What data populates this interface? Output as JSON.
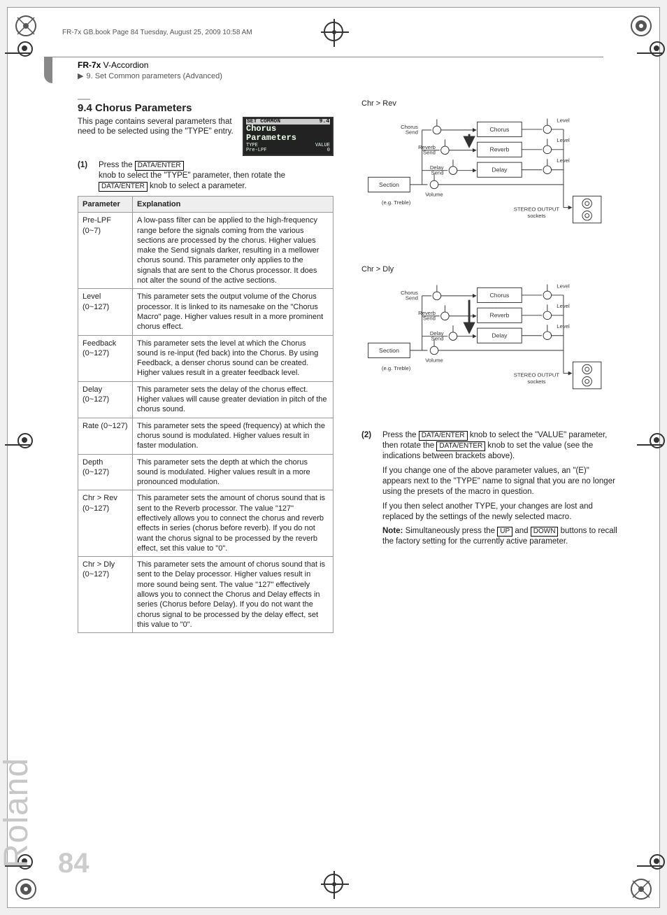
{
  "running_head": "FR-7x GB.book  Page 84  Tuesday, August 25, 2009  10:58 AM",
  "header": {
    "product_bold": "FR-7x",
    "product_rest": " V-Accordion",
    "section_nav": "9. Set Common parameters (Advanced)"
  },
  "section": {
    "title": "9.4 Chorus Parameters",
    "intro": "This page contains several parameters that need to be selected using the \"TYPE\" entry.",
    "lcd": {
      "bar_left": "SET COMMON",
      "bar_right": "9.4",
      "l2": "Chorus",
      "l3": "Parameters",
      "l4a": "TYPE",
      "l4b": "VALUE",
      "l5a": "Pre-LPF",
      "l5b": "0"
    }
  },
  "step1": {
    "num": "(1)",
    "line1_before": "Press the ",
    "btn": "DATA/ENTER",
    "line2": "knob to select the \"TYPE\" parameter, then rotate the ",
    "line3": " knob to select a parameter."
  },
  "table_head": {
    "c1": "Parameter",
    "c2": "Explanation"
  },
  "rows": [
    {
      "p": "Pre-LPF (0~7)",
      "e": "A low-pass filter can be applied to the high-frequency range before the signals coming from the various sections are processed by the chorus. Higher values make the Send signals darker, resulting in a mellower chorus sound. This parameter only applies to the signals that are sent to the Chorus processor. It does not alter the sound of the active sections."
    },
    {
      "p": "Level (0~127)",
      "e": "This parameter sets the output volume of the Chorus processor. It is linked to its namesake on the \"Chorus Macro\" page. Higher values result in a more prominent chorus effect."
    },
    {
      "p": "Feedback (0~127)",
      "e": "This parameter sets the level at which the Chorus sound is re-input (fed back) into the Chorus. By using Feedback, a denser chorus sound can be created. Higher values result in a greater feedback level."
    },
    {
      "p": "Delay (0~127)",
      "e": "This parameter sets the delay of the chorus effect. Higher values will cause greater deviation in pitch of the chorus sound."
    },
    {
      "p": "Rate (0~127)",
      "e": "This parameter sets the speed (frequency) at which the chorus sound is modulated. Higher values result in faster modulation."
    },
    {
      "p": "Depth (0~127)",
      "e": "This parameter sets the depth at which the chorus sound is modulated. Higher values result in a more pronounced modulation."
    },
    {
      "p": "Chr > Rev (0~127)",
      "e": "This parameter sets the amount of chorus sound that is sent to the Reverb processor. The value \"127\" effectively allows you to connect the chorus and reverb effects in series (chorus before reverb). If you do not want the chorus signal to be processed by the reverb effect, set this value to \"0\"."
    },
    {
      "p": "Chr > Dly (0~127)",
      "e": "This parameter sets the amount of chorus sound that is sent to the Delay processor. Higher values result in more sound being sent. The value \"127\" effectively allows you to connect the Chorus and Delay effects in series (Chorus before Delay). If you do not want the chorus signal to be processed by the delay effect, set this value to \"0\"."
    }
  ],
  "diagrams": {
    "d1": {
      "title": "Chr > Rev",
      "section": "Section",
      "section_eg": "(e.g. Treble)",
      "volume": "Volume",
      "chorus_send": "Chorus\nSend",
      "reverb_send": "Reverb\nSend",
      "delay_send": "Delay\nSend",
      "chorus": "Chorus",
      "reverb": "Reverb",
      "delay": "Delay",
      "level": "Level",
      "out": "STEREO OUTPUT\nsockets"
    },
    "d2": {
      "title": "Chr > Dly"
    }
  },
  "step2": {
    "num": "(2)",
    "t1a": "Press the ",
    "t1b": " knob to select the \"VALUE\" parameter, then rotate the ",
    "t1c": " knob to set the value (see the indications between brackets above).",
    "p2": "If you change one of the above parameter values, an \"(E)\" appears next to the \"TYPE\" name to signal that you are no longer using the presets of the macro in question.",
    "p3": "If you then select another TYPE, your changes are lost and replaced by the settings of the newly selected macro.",
    "noteLabel": "Note:",
    "note_a": " Simultaneously press the ",
    "up": "UP",
    "note_b": " and ",
    "down": "DOWN",
    "note_c": " buttons to recall the factory setting for the currently active parameter."
  },
  "brand": "Roland",
  "page_number": "84"
}
